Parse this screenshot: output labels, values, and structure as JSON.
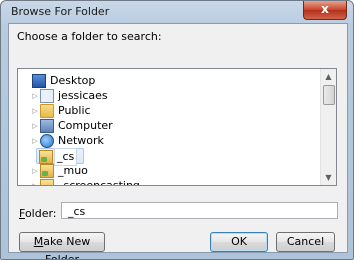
{
  "window": {
    "title": "Browse For Folder",
    "close_glyph": "x"
  },
  "prompt": "Choose a folder to search:",
  "tree": {
    "items": [
      {
        "label": "Desktop",
        "icon": "desktop-icon",
        "expander": false,
        "selected": false
      },
      {
        "label": "jessicaes",
        "icon": "user-icon",
        "expander": true,
        "selected": false
      },
      {
        "label": "Public",
        "icon": "folder-icon",
        "expander": true,
        "selected": false
      },
      {
        "label": "Computer",
        "icon": "computer-icon",
        "expander": true,
        "selected": false
      },
      {
        "label": "Network",
        "icon": "network-icon",
        "expander": true,
        "selected": false
      },
      {
        "label": "_cs",
        "icon": "library-folder-icon",
        "expander": false,
        "selected": true
      },
      {
        "label": "_muo",
        "icon": "library-folder-icon",
        "expander": true,
        "selected": false
      },
      {
        "label": "_screencasting",
        "icon": "library-folder-icon",
        "expander": true,
        "selected": false
      }
    ],
    "expander_glyph": "▷"
  },
  "folder_field": {
    "label_prefix": "F",
    "label_rest": "older:",
    "value": "_cs"
  },
  "buttons": {
    "make_new_folder": {
      "mnemonic": "M",
      "rest": "ake New Folder"
    },
    "ok": "OK",
    "cancel": "Cancel"
  },
  "scrollbar": {
    "up_glyph": "▲",
    "down_glyph": "▼",
    "position": 0.0
  }
}
